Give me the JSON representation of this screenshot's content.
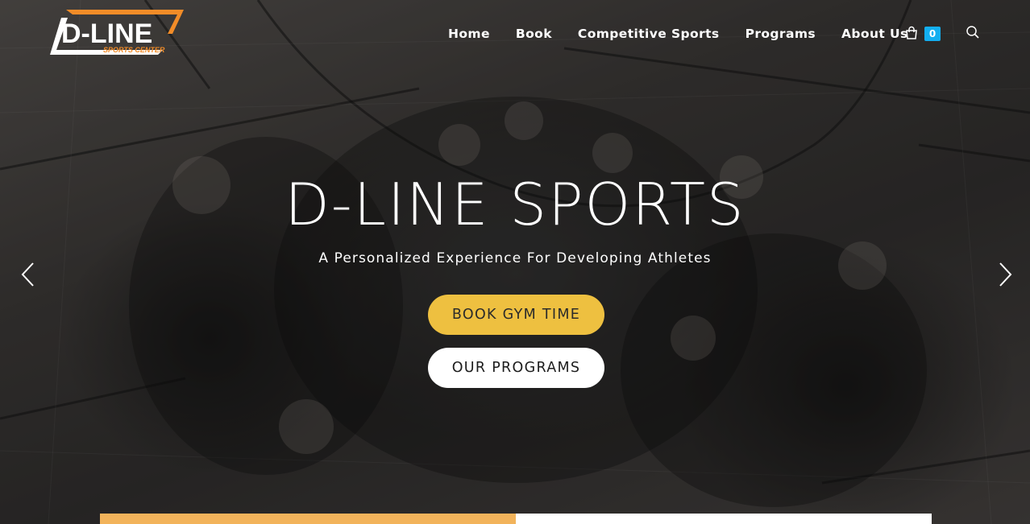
{
  "brand": {
    "logo_main": "D-LINE",
    "logo_sub": "SPORTS CENTER",
    "accent_color": "#f28c28"
  },
  "nav": {
    "items": [
      {
        "label": "Home"
      },
      {
        "label": "Book"
      },
      {
        "label": "Competitive Sports"
      },
      {
        "label": "Programs"
      },
      {
        "label": "About Us"
      }
    ],
    "cart_count": "0",
    "cart_icon": "shopping-bag-icon",
    "search_icon": "search-icon",
    "badge_color": "#13aff0"
  },
  "hero": {
    "title": "D-LINE SPORTS",
    "subtitle": "A Personalized Experience For Developing Athletes",
    "primary_button": "BOOK GYM TIME",
    "secondary_button": "OUR PROGRAMS",
    "primary_button_color": "#eec040",
    "prev_icon": "chevron-left-icon",
    "next_icon": "chevron-right-icon"
  }
}
